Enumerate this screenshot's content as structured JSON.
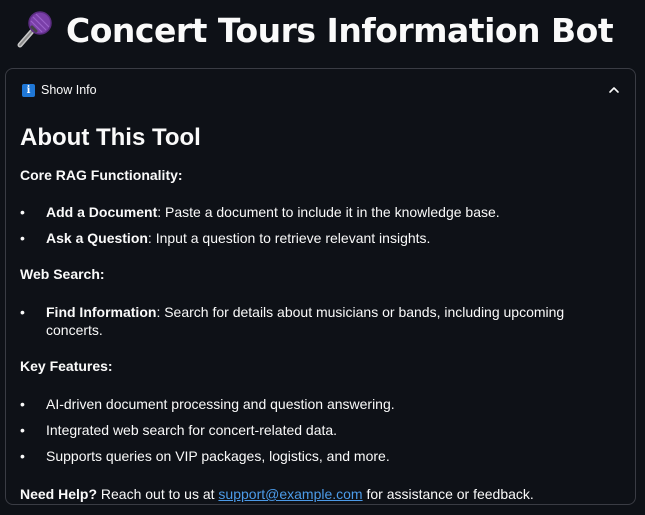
{
  "app": {
    "title": "Concert Tours Information Bot",
    "title_icon": "microphone-icon"
  },
  "expander": {
    "label": "Show Info",
    "icon": "info-icon",
    "state": "expanded"
  },
  "about": {
    "heading": "About This Tool",
    "core": {
      "heading": "Core RAG Functionality:",
      "items": [
        {
          "bold": "Add a Document",
          "text": ": Paste a document to include it in the knowledge base."
        },
        {
          "bold": "Ask a Question",
          "text": ": Input a question to retrieve relevant insights."
        }
      ]
    },
    "web": {
      "heading": "Web Search:",
      "items": [
        {
          "bold": "Find Information",
          "text": ": Search for details about musicians or bands, including upcoming concerts."
        }
      ]
    },
    "features": {
      "heading": "Key Features:",
      "items": [
        "AI-driven document processing and question answering.",
        "Integrated web search for concert-related data.",
        "Supports queries on VIP packages, logistics, and more."
      ]
    },
    "help": {
      "bold": "Need Help?",
      "prefix": " Reach out to us at ",
      "email": "support@example.com",
      "suffix": " for assistance or feedback."
    }
  },
  "colors": {
    "background": "#0e1117",
    "text": "#fafafa",
    "link": "#4c9be8",
    "border": "#3a3c44",
    "info_icon": "#1f77d6"
  }
}
